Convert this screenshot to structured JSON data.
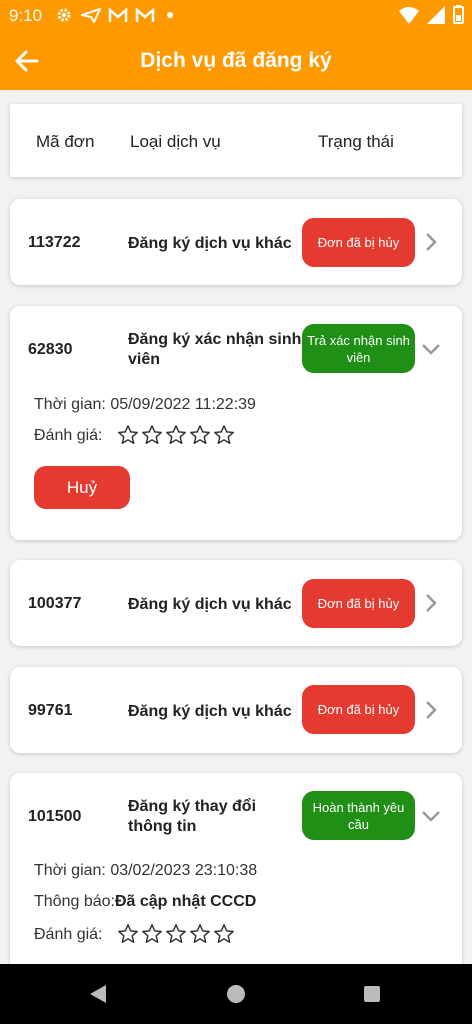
{
  "status_bar": {
    "time": "9:10",
    "icons": [
      "gear-icon",
      "send-icon",
      "gmail-icon",
      "gmail-icon",
      "dot-icon",
      "wifi-icon",
      "signal-icon",
      "battery-icon"
    ]
  },
  "app_bar": {
    "title": "Dịch vụ đã đăng ký",
    "back_icon": "arrow-left-icon"
  },
  "table_header": {
    "col_id": "Mã đơn",
    "col_service": "Loại dịch vụ",
    "col_status": "Trạng thái"
  },
  "colors": {
    "primary": "#ff9900",
    "status_cancelled": "#e53a2f",
    "status_done": "#1f8f16"
  },
  "labels": {
    "time": "Thời gian:",
    "rating": "Đánh giá:",
    "notice": "Thông báo:",
    "cancel_button": "Huỷ"
  },
  "orders": [
    {
      "id": "113722",
      "service": "Đăng ký dịch vụ khác",
      "status": "Đơn đã bị hủy",
      "expanded": false
    },
    {
      "id": "62830",
      "service": "Đăng ký xác nhận sinh viên",
      "status": "Trả xác nhận sinh viên",
      "expanded": true,
      "time": "05/09/2022 11:22:39",
      "rating": 0
    },
    {
      "id": "100377",
      "service": "Đăng ký dịch vụ khác",
      "status": "Đơn đã bị hủy",
      "expanded": false
    },
    {
      "id": "99761",
      "service": "Đăng ký dịch vụ khác",
      "status": "Đơn đã bị hủy",
      "expanded": false
    },
    {
      "id": "101500",
      "service": "Đăng ký thay đổi thông tin",
      "status": "Hoàn thành yêu cầu",
      "expanded": true,
      "time": "03/02/2023 23:10:38",
      "notice": "Đã cập nhật CCCD",
      "rating": 0
    }
  ]
}
